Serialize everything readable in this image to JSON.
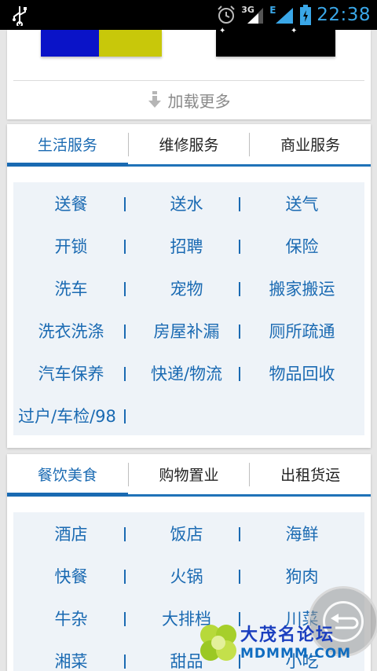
{
  "status_bar": {
    "time": "22:38",
    "network_label": "3G",
    "data_label": "E",
    "icons": [
      "usb-icon",
      "alarm-icon",
      "signal-icon",
      "signal-icon",
      "battery-icon"
    ]
  },
  "top_card": {
    "load_more_label": "加载更多",
    "thumbnail_colors": [
      "#0a13c8",
      "#c8c80a",
      "#000000"
    ]
  },
  "section_1": {
    "tabs": [
      {
        "label": "生活服务",
        "active": true
      },
      {
        "label": "维修服务",
        "active": false
      },
      {
        "label": "商业服务",
        "active": false
      }
    ],
    "rows": [
      [
        "送餐",
        "送水",
        "送气"
      ],
      [
        "开锁",
        "招聘",
        "保险"
      ],
      [
        "洗车",
        "宠物",
        "搬家搬运"
      ],
      [
        "洗衣洗涤",
        "房屋补漏",
        "厕所疏通"
      ],
      [
        "汽车保养",
        "快递/物流",
        "物品回收"
      ]
    ],
    "last_item": "过户/车检/98"
  },
  "section_2": {
    "tabs": [
      {
        "label": "餐饮美食",
        "active": true
      },
      {
        "label": "购物置业",
        "active": false
      },
      {
        "label": "出租货运",
        "active": false
      }
    ],
    "rows": [
      [
        "酒店",
        "饭店",
        "海鲜"
      ],
      [
        "快餐",
        "火锅",
        "狗肉"
      ],
      [
        "牛杂",
        "大排档",
        "川菜"
      ],
      [
        "湘菜",
        "甜品",
        "小吃"
      ]
    ]
  },
  "watermark": {
    "title": "大茂名论坛",
    "subtitle": "MDMMM.COM"
  },
  "colors": {
    "accent": "#1a6ab2",
    "panel_bg": "#eef3f8",
    "time_color": "#3aa7e8"
  }
}
